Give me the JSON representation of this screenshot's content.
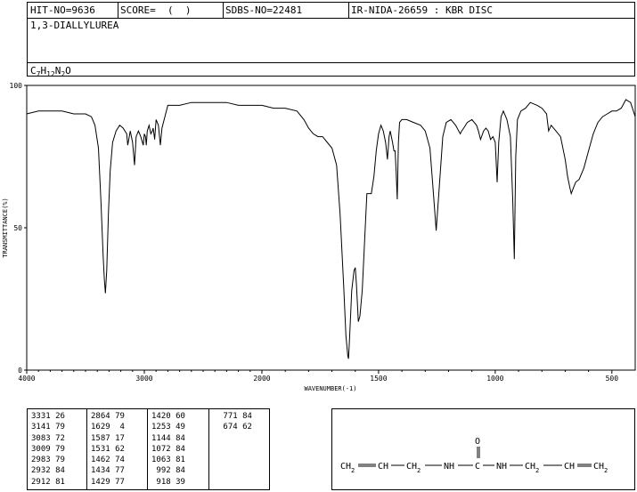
{
  "header": {
    "hit_no": "HIT-NO=9636",
    "score": "SCORE=  (  )",
    "sdbs_no": "SDBS-NO=22481",
    "ir_code": "IR-NIDA-26659 : KBR DISC",
    "compound": "1,3-DIALLYLUREA",
    "formula": {
      "c": "C",
      "c_n": "7",
      "h": "H",
      "h_n": "12",
      "n": "N",
      "n_n": "2",
      "o": "O"
    }
  },
  "chart_data": {
    "type": "line",
    "xlabel": "WAVENUMBER(-1)",
    "ylabel": "TRANSMITTANCE(%)",
    "xlim": [
      4000,
      400
    ],
    "ylim": [
      0,
      100
    ],
    "xticks": [
      "4000",
      "3000",
      "2000",
      "1500",
      "1000",
      "500"
    ],
    "yticks": [
      "100",
      "50",
      "0"
    ],
    "line_color": "#000000",
    "series": [
      {
        "x": [
          4000,
          3900,
          3800,
          3700,
          3600,
          3500,
          3450,
          3420,
          3390,
          3370,
          3350,
          3340,
          3331,
          3320,
          3305,
          3290,
          3270,
          3240,
          3210,
          3180,
          3150,
          3141,
          3120,
          3100,
          3083,
          3070,
          3050,
          3030,
          3009,
          3000,
          2990,
          2983,
          2975,
          2960,
          2945,
          2932,
          2925,
          2915,
          2912,
          2900,
          2880,
          2864,
          2850,
          2800,
          2700,
          2600,
          2500,
          2400,
          2300,
          2200,
          2100,
          2000,
          1950,
          1900,
          1850,
          1820,
          1800,
          1780,
          1760,
          1740,
          1720,
          1700,
          1680,
          1665,
          1650,
          1640,
          1632,
          1629,
          1624,
          1615,
          1605,
          1600,
          1595,
          1590,
          1587,
          1580,
          1570,
          1560,
          1550,
          1540,
          1531,
          1520,
          1510,
          1500,
          1490,
          1480,
          1470,
          1462,
          1455,
          1450,
          1445,
          1440,
          1434,
          1429,
          1425,
          1420,
          1415,
          1410,
          1400,
          1380,
          1350,
          1320,
          1300,
          1280,
          1265,
          1253,
          1240,
          1225,
          1210,
          1190,
          1170,
          1150,
          1144,
          1135,
          1120,
          1100,
          1080,
          1072,
          1063,
          1050,
          1040,
          1030,
          1020,
          1010,
          1000,
          992,
          985,
          975,
          965,
          950,
          935,
          925,
          918,
          912,
          905,
          890,
          870,
          850,
          820,
          800,
          790,
          780,
          771,
          760,
          740,
          720,
          700,
          690,
          680,
          674,
          665,
          655,
          640,
          620,
          600,
          580,
          560,
          540,
          520,
          500,
          480,
          460,
          440,
          420,
          400
        ],
        "values": [
          90,
          91,
          91,
          91,
          90,
          90,
          89,
          86,
          78,
          60,
          40,
          32,
          27,
          35,
          55,
          70,
          80,
          84,
          86,
          85,
          83,
          79,
          84,
          80,
          72,
          82,
          84,
          82,
          79,
          83,
          82,
          79,
          84,
          86,
          83,
          84,
          85,
          82,
          81,
          88,
          86,
          79,
          85,
          93,
          93,
          94,
          94,
          94,
          94,
          93,
          93,
          93,
          92,
          92,
          91,
          88,
          85,
          83,
          82,
          82,
          80,
          78,
          72,
          55,
          30,
          12,
          5,
          4,
          12,
          28,
          35,
          36,
          30,
          22,
          17,
          19,
          28,
          45,
          62,
          62,
          62,
          68,
          77,
          83,
          86,
          84,
          80,
          74,
          82,
          84,
          82,
          80,
          77,
          77,
          70,
          60,
          80,
          87,
          88,
          88,
          87,
          86,
          84,
          78,
          62,
          49,
          64,
          82,
          87,
          88,
          86,
          83,
          84,
          85,
          87,
          88,
          86,
          84,
          81,
          84,
          85,
          84,
          81,
          82,
          80,
          66,
          80,
          89,
          91,
          88,
          82,
          60,
          39,
          75,
          88,
          91,
          92,
          94,
          93,
          92,
          91,
          90,
          84,
          86,
          84,
          82,
          74,
          68,
          64,
          62,
          64,
          66,
          67,
          71,
          77,
          83,
          87,
          89,
          90,
          91,
          91,
          92,
          95,
          94,
          89
        ]
      }
    ]
  },
  "peak_table": {
    "columns": [
      [
        "3331 26",
        "3141 79",
        "3083 72",
        "3009 79",
        "2983 79",
        "2932 84",
        "2912 81"
      ],
      [
        "2864 79",
        "1629  4",
        "1587 17",
        "1531 62",
        "1462 74",
        "1434 77",
        "1429 77"
      ],
      [
        "1420 60",
        "1253 49",
        "1144 84",
        "1072 84",
        "1063 81",
        " 992 84",
        " 918 39"
      ],
      [
        " 771 84",
        " 674 62"
      ]
    ]
  },
  "structure": {
    "chain": "CH2=CH-CH2-NH-C-NH-CH2-CH=CH2",
    "labels": [
      "CH",
      "2",
      "CH",
      "CH",
      "2",
      "NH",
      "C",
      "NH",
      "CH",
      "2",
      "CH",
      "CH",
      "2",
      "O"
    ]
  }
}
